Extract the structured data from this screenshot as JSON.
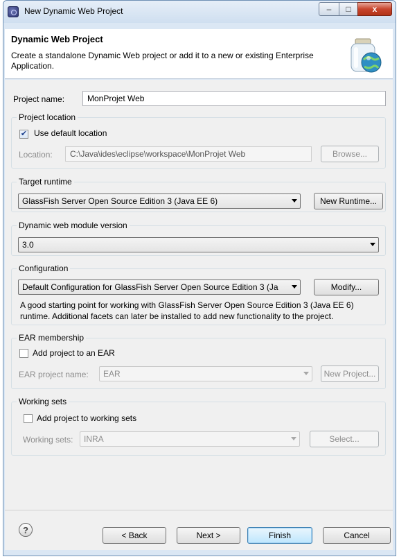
{
  "window": {
    "title": "New Dynamic Web Project"
  },
  "header": {
    "title": "Dynamic Web Project",
    "description": "Create a standalone Dynamic Web project or add it to a new or existing Enterprise Application."
  },
  "project_name": {
    "label": "Project name:",
    "value": "MonProjet Web"
  },
  "project_location": {
    "title": "Project location",
    "use_default_label": "Use default location",
    "use_default_checked": true,
    "location_label": "Location:",
    "location_value": "C:\\Java\\ides\\eclipse\\workspace\\MonProjet Web",
    "browse_label": "Browse..."
  },
  "target_runtime": {
    "title": "Target runtime",
    "selected": "GlassFish Server Open Source Edition 3 (Java EE 6)",
    "new_runtime_label": "New Runtime..."
  },
  "module_version": {
    "title": "Dynamic web module version",
    "selected": "3.0"
  },
  "configuration": {
    "title": "Configuration",
    "selected": "Default Configuration for GlassFish Server Open Source Edition 3 (Ja",
    "modify_label": "Modify...",
    "description_line1": "A good starting point for working with GlassFish Server Open Source Edition 3 (Java EE 6)",
    "description_line2": "runtime. Additional facets can later be installed to add new functionality to the project."
  },
  "ear_membership": {
    "title": "EAR membership",
    "add_label": "Add project to an EAR",
    "add_checked": false,
    "name_label": "EAR project name:",
    "name_value": "EAR",
    "new_project_label": "New Project..."
  },
  "working_sets": {
    "title": "Working sets",
    "add_label": "Add project to working sets",
    "add_checked": false,
    "sets_label": "Working sets:",
    "sets_value": "INRA",
    "select_label": "Select..."
  },
  "footer": {
    "help_glyph": "?",
    "back_label": "< Back",
    "next_label": "Next >",
    "finish_label": "Finish",
    "cancel_label": "Cancel"
  },
  "icons": {
    "window_minimize": "–",
    "window_maximize": "□",
    "window_close": "x",
    "check_mark": "✔",
    "banner_icon": "web-project-jar-globe-icon"
  }
}
